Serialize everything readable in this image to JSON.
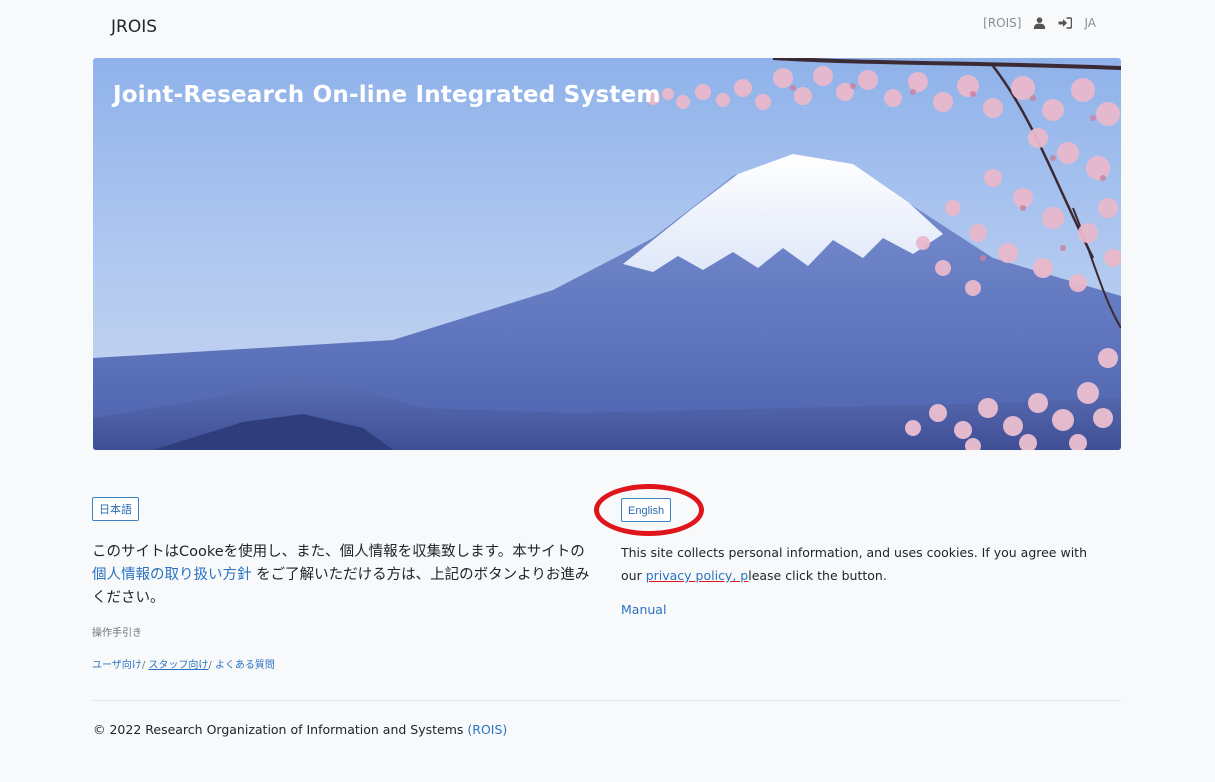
{
  "nav": {
    "brand": "JROIS",
    "org_label": "[ROIS]",
    "user_icon": "user-icon",
    "login_icon": "sign-in-icon",
    "lang_label": "JA"
  },
  "hero": {
    "title": "Joint-Research On-line Integrated System",
    "image": "mount-fuji-cherry-blossoms"
  },
  "japanese": {
    "button": "日本語",
    "text_before": "このサイトはCookeを使用し、また、個人情報を収集致します。本サイトの ",
    "policy_link": "個人情報の取り扱い方針",
    "text_after": " をご了解いただける方は、上記のボタンよりお進みください。",
    "guide_label": "操作手引き",
    "guide_user": "ユーザ向け",
    "guide_sep": "/ ",
    "guide_staff": "スタッフ向け",
    "guide_faq": "よくある質問"
  },
  "english": {
    "button": "English",
    "text_before": "This site collects personal information, and uses cookies. If you agree with our ",
    "policy_link": "privacy policy, p",
    "text_after": "lease click the button.",
    "manual": "Manual"
  },
  "footer": {
    "copyright": "© 2022 Research Organization of Information and Systems ",
    "org_link": "(ROIS)"
  },
  "colors": {
    "link": "#2a73c2",
    "annotation_ring": "#e0141b"
  }
}
